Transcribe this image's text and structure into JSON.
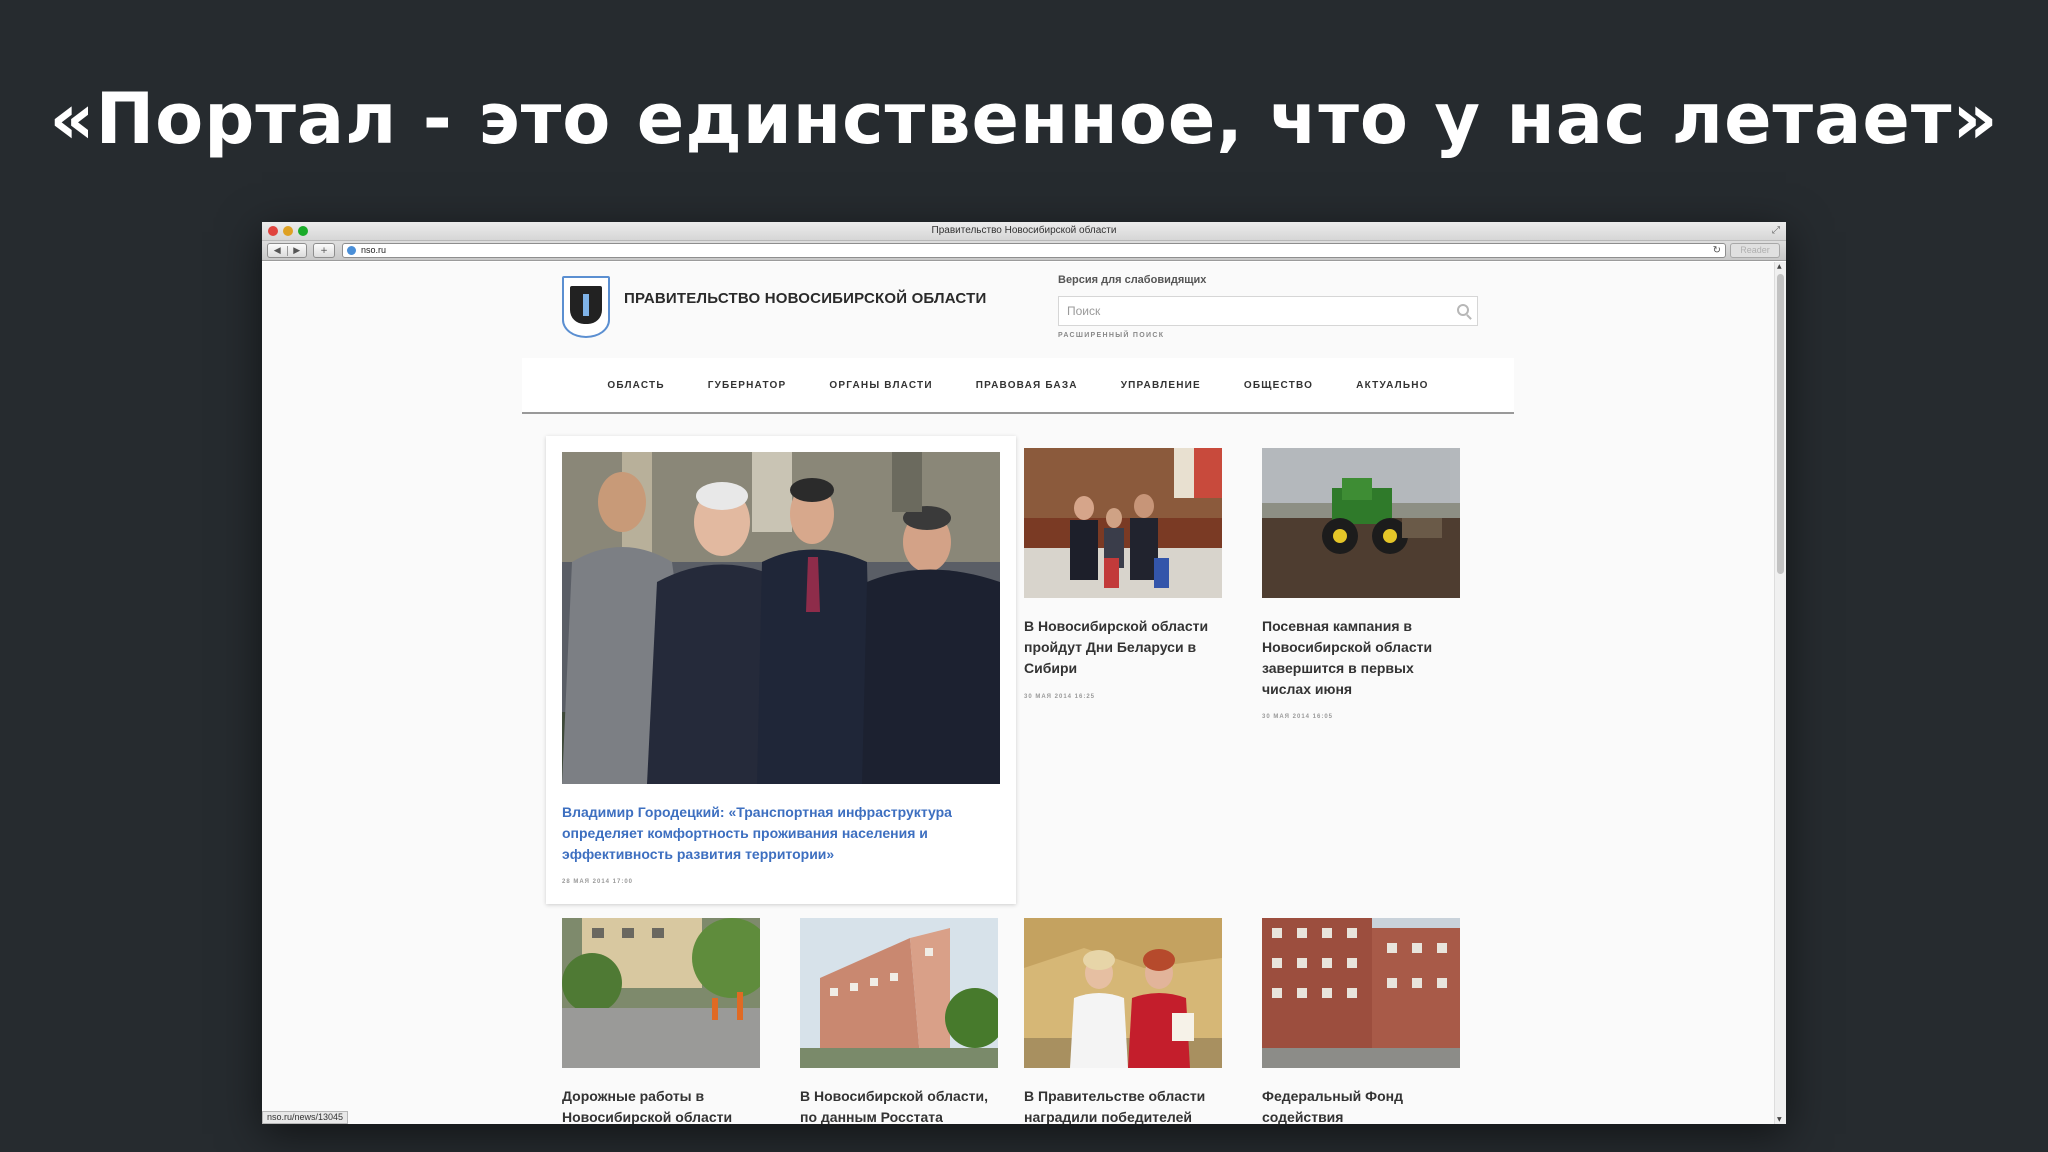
{
  "slide": {
    "title": "«Портал - это единственное, что у нас летает»"
  },
  "browser": {
    "window_title": "Правительство Новосибирской области",
    "url": "nso.ru",
    "reader_label": "Reader",
    "status_url": "nso.ru/news/13045",
    "back_glyph": "◀",
    "forward_glyph": "▶",
    "new_tab_glyph": "+"
  },
  "site": {
    "name": "ПРАВИТЕЛЬСТВО НОВОСИБИРСКОЙ ОБЛАСТИ",
    "blind_version": "Версия для слабовидящих",
    "search_placeholder": "Поиск",
    "advanced_search": "РАСШИРЕННЫЙ ПОИСК",
    "nav": [
      "ОБЛАСТЬ",
      "ГУБЕРНАТОР",
      "ОРГАНЫ ВЛАСТИ",
      "ПРАВОВАЯ БАЗА",
      "УПРАВЛЕНИЕ",
      "ОБЩЕСТВО",
      "АКТУАЛЬНО"
    ],
    "featured": {
      "title": "Владимир Городецкий: «Транспортная инфраструктура определяет комфортность проживания населения и эффективность развития территории»",
      "date": "28 МАЯ 2014 17:00"
    },
    "news": [
      {
        "title": "В Новосибирской области пройдут Дни Беларуси в Сибири",
        "date": "30 МАЯ 2014 16:25"
      },
      {
        "title": "Посевная кампания в Новосибирской области завершится в первых числах июня",
        "date": "30 МАЯ 2014 16:05"
      },
      {
        "title": "Дорожные работы в Новосибирской области",
        "date": ""
      },
      {
        "title": "В Новосибирской области, по данным Росстата",
        "date": ""
      },
      {
        "title": "В Правительстве области наградили победителей",
        "date": ""
      },
      {
        "title": "Федеральный Фонд содействия",
        "date": ""
      }
    ]
  }
}
